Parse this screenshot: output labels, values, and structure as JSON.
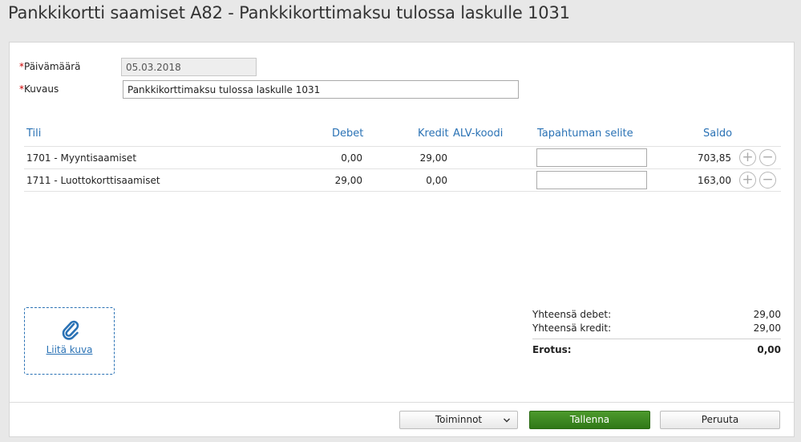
{
  "page": {
    "title": "Pankkikortti saamiset A82  -  Pankkikorttimaksu tulossa laskulle 1031"
  },
  "form": {
    "date_label": "Päivämäärä",
    "date_value": "05.03.2018",
    "desc_label": "Kuvaus",
    "desc_value": "Pankkikorttimaksu tulossa laskulle 1031",
    "required_mark": "*"
  },
  "grid": {
    "headers": {
      "account": "Tili",
      "debit": "Debet",
      "credit": "Kredit",
      "vat": "ALV-koodi",
      "explanation": "Tapahtuman selite",
      "balance": "Saldo"
    },
    "rows": [
      {
        "account": "1701 - Myyntisaamiset",
        "debit": "0,00",
        "credit": "29,00",
        "vat": "",
        "explanation": "",
        "balance": "703,85"
      },
      {
        "account": "1711 - Luottokorttisaamiset",
        "debit": "29,00",
        "credit": "0,00",
        "vat": "",
        "explanation": "",
        "balance": "163,00"
      }
    ],
    "add_glyph": "+",
    "remove_glyph": "−"
  },
  "attachment": {
    "icon": "paperclip-icon",
    "link_label": "Liitä kuva"
  },
  "totals": {
    "debit_label": "Yhteensä debet:",
    "debit_value": "29,00",
    "credit_label": "Yhteensä kredit:",
    "credit_value": "29,00",
    "diff_label": "Erotus:",
    "diff_value": "0,00"
  },
  "footer": {
    "actions_label": "Toiminnot",
    "save_label": "Tallenna",
    "cancel_label": "Peruuta"
  },
  "colors": {
    "link": "#2a72b5",
    "save_button": "#3a8320",
    "required": "#cc0000"
  }
}
